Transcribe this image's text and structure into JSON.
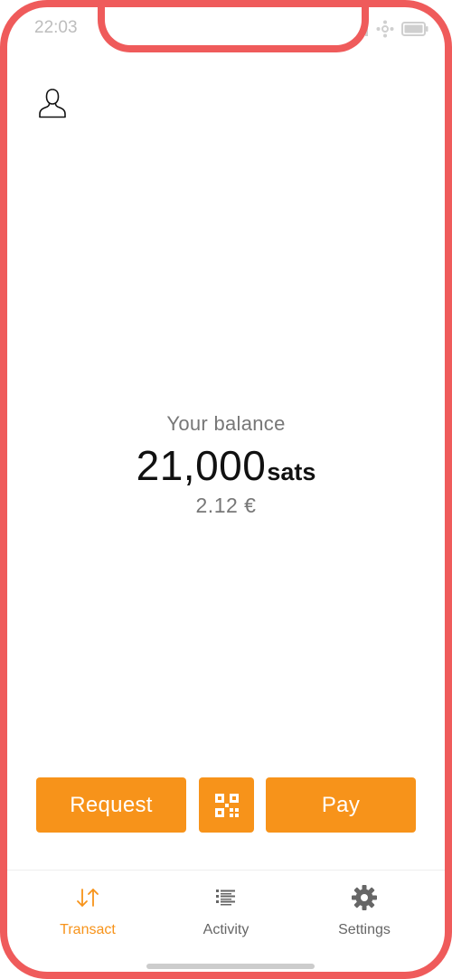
{
  "status_bar": {
    "time": "22:03",
    "icons": [
      "signal-icon",
      "network-icon",
      "battery-icon"
    ]
  },
  "header": {
    "profile_icon": "profile-icon"
  },
  "balance": {
    "label": "Your balance",
    "value": "21,000",
    "unit": "sats",
    "fiat": "2.12 €"
  },
  "actions": {
    "request_label": "Request",
    "qr_icon": "qr-code-icon",
    "pay_label": "Pay"
  },
  "tabs": [
    {
      "label": "Transact",
      "icon": "transact-arrows-icon",
      "active": true
    },
    {
      "label": "Activity",
      "icon": "list-icon",
      "active": false
    },
    {
      "label": "Settings",
      "icon": "gear-icon",
      "active": false
    }
  ],
  "colors": {
    "accent": "#F7931A",
    "frame": "#EF5B5B",
    "muted_text": "#777777",
    "primary_text": "#111111"
  }
}
